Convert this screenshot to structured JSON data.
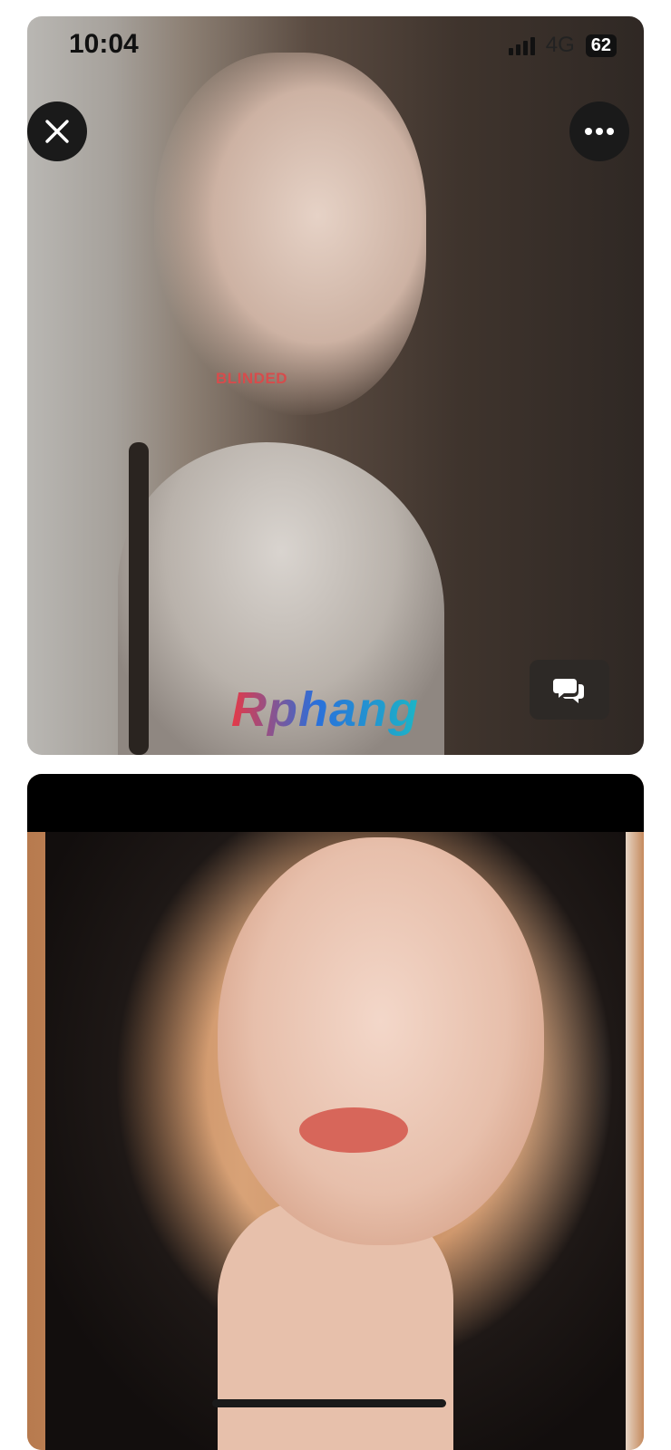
{
  "status_bar": {
    "time": "10:04",
    "network": "4G",
    "battery": "62"
  },
  "viewer": {
    "close_icon": "close-icon",
    "more_icon": "more-icon",
    "comment_icon": "comment-icon"
  },
  "photo_1": {
    "overlay_text": "BLINDED",
    "watermark": "Rphang"
  },
  "colors": {
    "button_bg": "#1a1a1a",
    "watermark_start": "#e63946",
    "watermark_end": "#1cb5c7"
  }
}
